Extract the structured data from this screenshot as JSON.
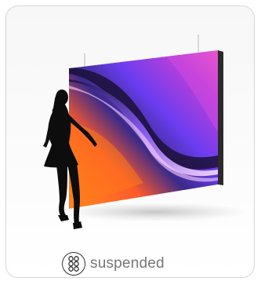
{
  "product_card": {
    "caption": "suspended",
    "mount_icon": "suspended-mount-icon"
  }
}
